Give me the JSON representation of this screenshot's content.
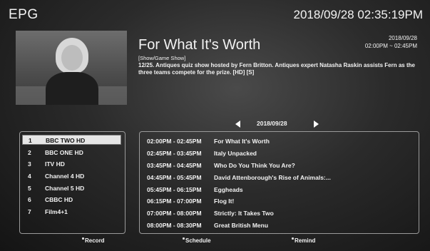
{
  "header": {
    "title": "EPG",
    "clock": "2018/09/28 02:35:19PM"
  },
  "program": {
    "title": "For What It's Worth",
    "date": "2018/09/28",
    "time": "02:00PM ~ 02:45PM",
    "genre": "[Show/Game Show]",
    "description": "12/25. Antiques quiz show hosted by Fern Britton. Antiques expert Natasha Raskin assists Fern as the three teams compete for the prize. [HD] [S]"
  },
  "date_nav": {
    "date": "2018/09/28"
  },
  "channels": [
    {
      "num": "1",
      "name": "BBC TWO HD",
      "selected": true
    },
    {
      "num": "2",
      "name": "BBC ONE HD"
    },
    {
      "num": "3",
      "name": "ITV HD"
    },
    {
      "num": "4",
      "name": "Channel 4 HD"
    },
    {
      "num": "5",
      "name": "Channel 5 HD"
    },
    {
      "num": "6",
      "name": "CBBC HD"
    },
    {
      "num": "7",
      "name": "Film4+1"
    }
  ],
  "schedule": [
    {
      "time": "02:00PM - 02:45PM",
      "title": "For What It's Worth"
    },
    {
      "time": "02:45PM - 03:45PM",
      "title": "Italy Unpacked"
    },
    {
      "time": "03:45PM - 04:45PM",
      "title": "Who Do You Think You Are?"
    },
    {
      "time": "04:45PM - 05:45PM",
      "title": "David Attenborough's Rise of Animals:..."
    },
    {
      "time": "05:45PM - 06:15PM",
      "title": "Eggheads"
    },
    {
      "time": "06:15PM - 07:00PM",
      "title": "Flog It!"
    },
    {
      "time": "07:00PM - 08:00PM",
      "title": "Strictly: It Takes Two"
    },
    {
      "time": "08:00PM - 08:30PM",
      "title": "Great British Menu"
    }
  ],
  "footer": {
    "record": "Record",
    "schedule": "Schedule",
    "remind": "Remind"
  }
}
